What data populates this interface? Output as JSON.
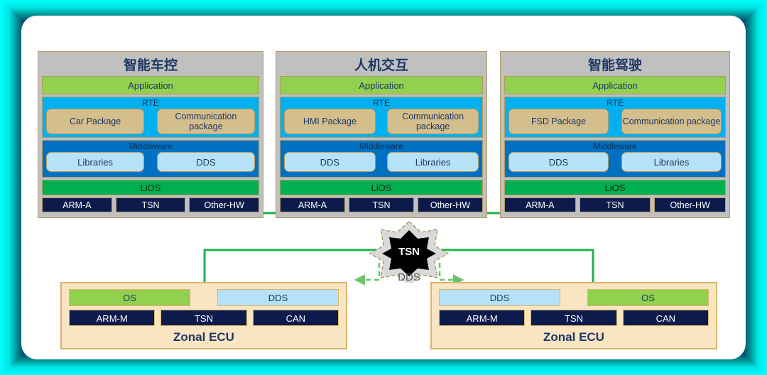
{
  "theme": {
    "accent_green": "#00B050",
    "arrow_green": "#22B14C",
    "app_green": "#92D050",
    "rte_cyan": "#00B0F0",
    "middleware_blue": "#0070C0",
    "hardware_navy": "#0D1B4C",
    "package_tan": "#D4BE8C",
    "lib_lightblue": "#B6E2F7",
    "panel_gray": "#C0C0C0",
    "ecu_cream": "#FAE5C3",
    "border_tan": "#B39B63",
    "frame_cyan": "#00FFFF",
    "frame_navy": "#000D33"
  },
  "panels": [
    {
      "title": "智能车控",
      "application": "Application",
      "rte": {
        "label": "RTE",
        "packages": [
          "Car Package",
          "Communication package"
        ]
      },
      "middleware": {
        "label": "Middleware",
        "libs": [
          "Libraries",
          "DDS"
        ]
      },
      "os": "LiOS",
      "hardware": [
        "ARM-A",
        "TSN",
        "Other-HW"
      ]
    },
    {
      "title": "人机交互",
      "application": "Application",
      "rte": {
        "label": "RTE",
        "packages": [
          "HMI Package",
          "Communication package"
        ]
      },
      "middleware": {
        "label": "Middleware",
        "libs": [
          "DDS",
          "Libraries"
        ]
      },
      "os": "LiOS",
      "hardware": [
        "ARM-A",
        "TSN",
        "Other-HW"
      ]
    },
    {
      "title": "智能驾驶",
      "application": "Application",
      "rte": {
        "label": "RTE",
        "packages": [
          "FSD Package",
          "Communication package"
        ]
      },
      "middleware": {
        "label": "Middleware",
        "libs": [
          "DDS",
          "Libraries"
        ]
      },
      "os": "LiOS",
      "hardware": [
        "ARM-A",
        "TSN",
        "Other-HW"
      ]
    }
  ],
  "hub": {
    "center_label": "TSN",
    "bottom_label": "DDS"
  },
  "ecus": [
    {
      "title": "Zonal ECU",
      "top_left": "OS",
      "top_right": "DDS",
      "hardware": [
        "ARM-M",
        "TSN",
        "CAN"
      ]
    },
    {
      "title": "Zonal ECU",
      "top_left": "DDS",
      "top_right": "OS",
      "hardware": [
        "ARM-M",
        "TSN",
        "CAN"
      ]
    }
  ]
}
